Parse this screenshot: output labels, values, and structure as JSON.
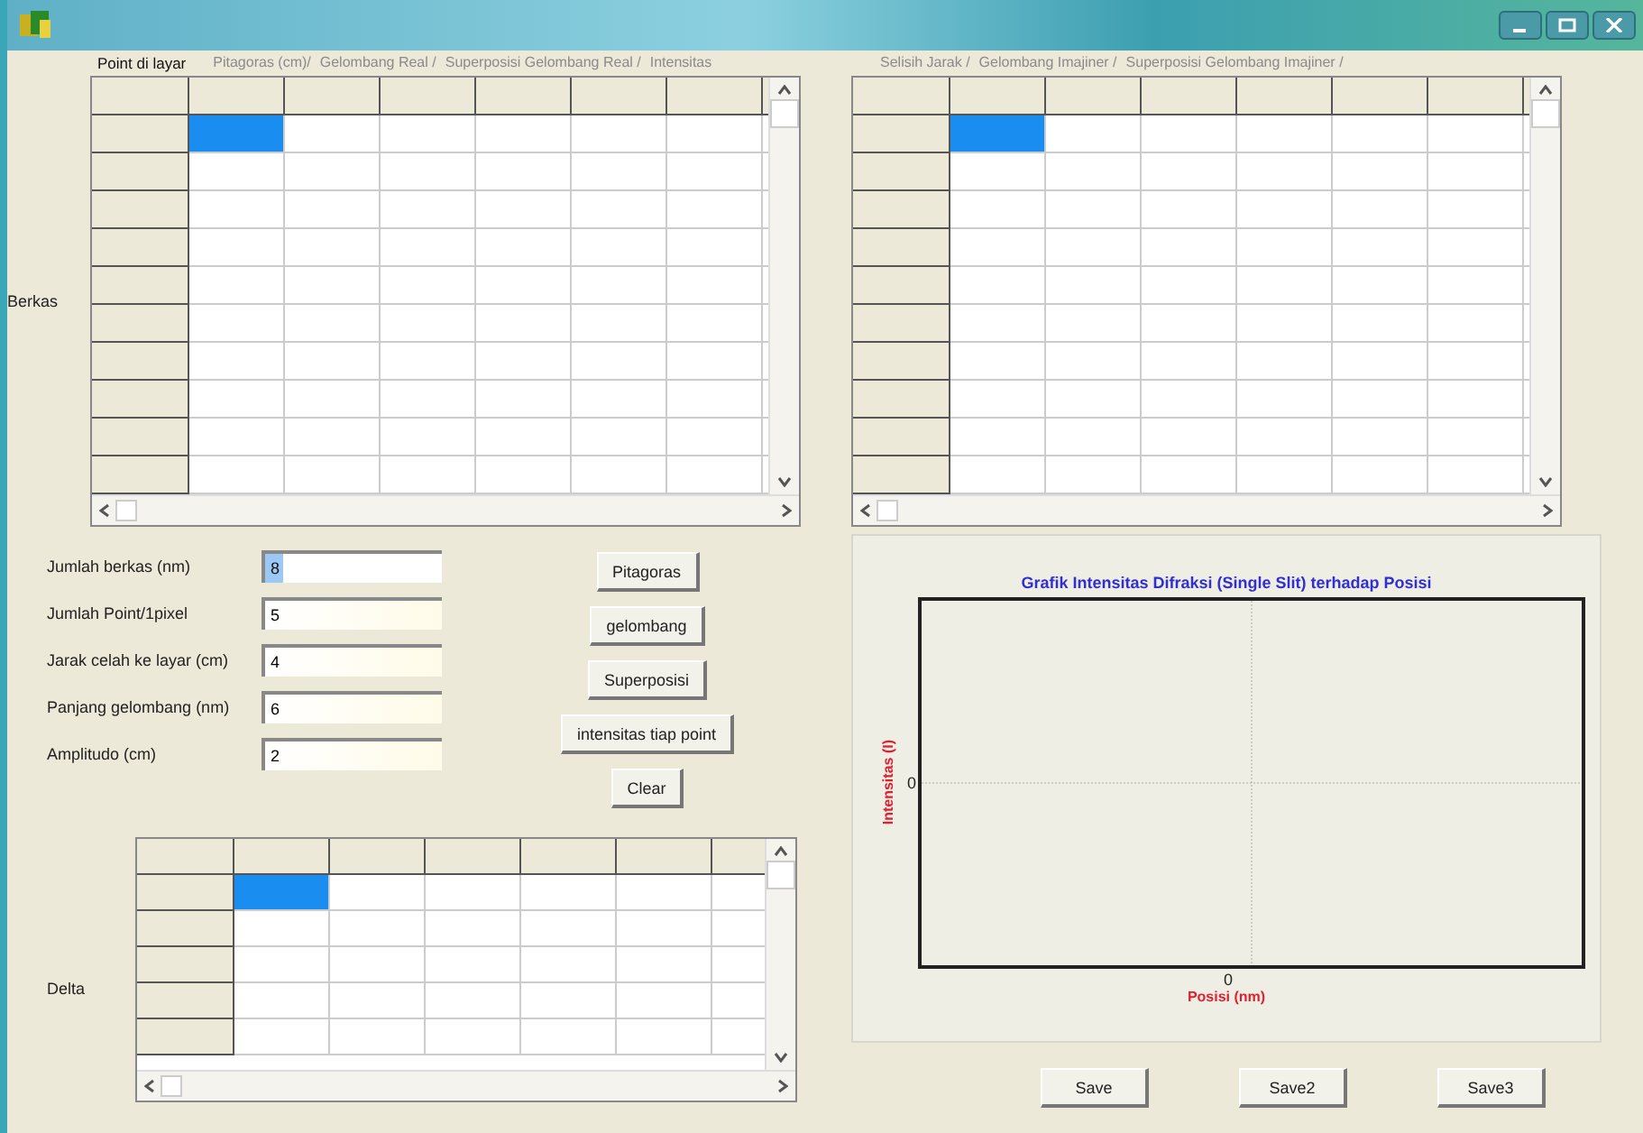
{
  "left_tabs": [
    {
      "label": "Point di layar",
      "selected": true
    },
    {
      "label": "Pitagoras (cm)/",
      "selected": false
    },
    {
      "label": "Gelombang Real /",
      "selected": false
    },
    {
      "label": "Superposisi Gelombang Real /",
      "selected": false
    },
    {
      "label": "Intensitas",
      "selected": false
    }
  ],
  "right_tabs": [
    {
      "label": "Selisih Jarak /",
      "selected": false
    },
    {
      "label": "Gelombang Imajiner /",
      "selected": false
    },
    {
      "label": "Superposisi Gelombang Imajiner /",
      "selected": false
    }
  ],
  "grid_left": {
    "label": "Berkas",
    "rows": [
      {
        "selected": true
      },
      {
        "selected": false
      },
      {
        "selected": false
      },
      {
        "selected": false
      },
      {
        "selected": false
      },
      {
        "selected": false
      },
      {
        "selected": false
      },
      {
        "selected": false
      },
      {
        "selected": false
      },
      {
        "selected": false
      }
    ]
  },
  "grid_right": {
    "rows": [
      {
        "selected": true
      },
      {
        "selected": false
      },
      {
        "selected": false
      },
      {
        "selected": false
      },
      {
        "selected": false
      },
      {
        "selected": false
      },
      {
        "selected": false
      },
      {
        "selected": false
      },
      {
        "selected": false
      },
      {
        "selected": false
      }
    ]
  },
  "fields": [
    {
      "label": "Jumlah berkas (nm)",
      "value": "8",
      "selected": true
    },
    {
      "label": "Jumlah Point/1pixel",
      "value": "5",
      "selected": false
    },
    {
      "label": "Jarak celah ke layar (cm)",
      "value": "4",
      "selected": false
    },
    {
      "label": "Panjang gelombang (nm)",
      "value": "6",
      "selected": false
    },
    {
      "label": "Amplitudo (cm)",
      "value": "2",
      "selected": false
    }
  ],
  "buttons": [
    "Pitagoras",
    "gelombang",
    "Superposisi",
    "intensitas tiap point",
    "Clear"
  ],
  "grid_delta": {
    "label": "Delta",
    "rows": [
      {
        "selected": true
      },
      {
        "selected": false
      },
      {
        "selected": false
      },
      {
        "selected": false
      },
      {
        "selected": false
      }
    ]
  },
  "chart": {
    "title": "Grafik Intensitas Difraksi (Single Slit) terhadap Posisi",
    "xlabel": "Posisi (nm)",
    "ylabel": "Intensitas (I)",
    "xtick": "0",
    "ytick": "0"
  },
  "save_buttons": [
    "Save",
    "Save2",
    "Save3"
  ]
}
